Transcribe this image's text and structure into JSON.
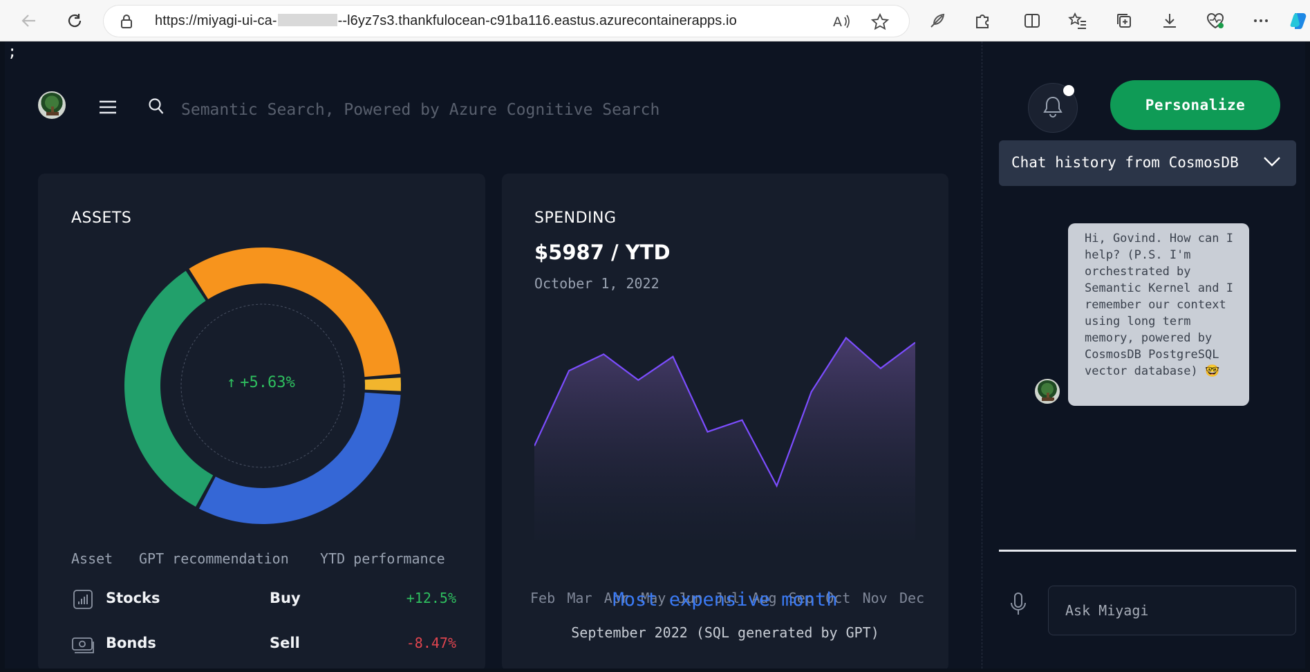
{
  "browser": {
    "url_prefix": "https://miyagi-ui-ca-",
    "url_suffix": "--l6yz7s3.thankfulocean-c91ba116.eastus.azurecontainerapps.io"
  },
  "app": {
    "stray_char": ";",
    "search_placeholder": "Semantic Search, Powered by Azure Cognitive Search"
  },
  "assets": {
    "title": "ASSETS",
    "center_label": "+5.63%",
    "donut_segments": [
      {
        "name": "orange",
        "fraction": 0.33,
        "color": "#f7941d"
      },
      {
        "name": "yellow",
        "fraction": 0.02,
        "color": "#f2b52d"
      },
      {
        "name": "blue",
        "fraction": 0.32,
        "color": "#3567d6"
      },
      {
        "name": "green",
        "fraction": 0.33,
        "color": "#22a06b"
      }
    ],
    "columns": [
      "Asset",
      "GPT recommendation",
      "YTD performance"
    ],
    "rows": [
      {
        "icon": "stocks-chart-icon",
        "name": "Stocks",
        "recommendation": "Buy",
        "performance": "+12.5%",
        "color": "#2fbf5f"
      },
      {
        "icon": "bonds-cash-icon",
        "name": "Bonds",
        "recommendation": "Sell",
        "performance": "-8.47%",
        "color": "#e0454f"
      }
    ]
  },
  "spending": {
    "title": "SPENDING",
    "amount": "$5987 / YTD",
    "date": "October 1, 2022",
    "most_expensive_label": "Most expensive month",
    "most_expensive_value": "September 2022 (SQL generated by GPT)"
  },
  "chart_data": {
    "type": "area",
    "categories": [
      "Feb",
      "Mar",
      "Apr",
      "May",
      "Jun",
      "Jul",
      "Aug",
      "Sep",
      "Oct",
      "Nov",
      "Dec"
    ],
    "values": [
      40,
      72,
      79,
      68,
      78,
      46,
      51,
      23,
      63,
      86,
      73,
      84
    ],
    "ylim": [
      0,
      100
    ],
    "line_color": "#7c4dff",
    "grid": false
  },
  "right_panel": {
    "personalize_label": "Personalize",
    "chat_history_label": "Chat history from CosmosDB",
    "bot_message": "Hi, Govind. How can I help? (P.S. I'm orchestrated by Semantic Kernel and I remember our context using long term memory, powered by CosmosDB PostgreSQL vector database) 🤓",
    "ask_placeholder": "Ask Miyagi"
  }
}
